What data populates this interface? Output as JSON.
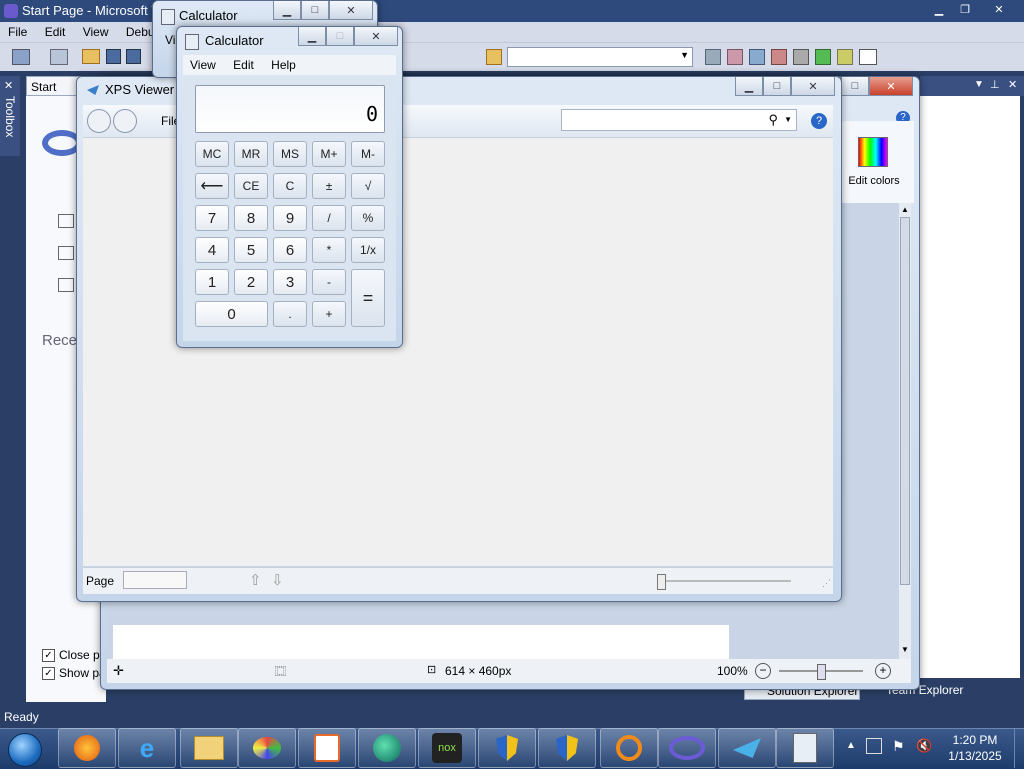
{
  "vs": {
    "title": "Start Page - Microsoft V",
    "menu": [
      "File",
      "Edit",
      "View",
      "Debug"
    ],
    "start_tab": "Start Page",
    "toolbox": "Toolbox",
    "recent": "Rece",
    "close_page": "Close pa",
    "show_page": "Show pa",
    "status": "Ready",
    "solution_explorer": "Solution Explorer",
    "team_explorer": "Team Explorer"
  },
  "calc_back": {
    "title": "Calculator",
    "menu_fragment": "Vi"
  },
  "calc": {
    "title": "Calculator",
    "menu": [
      "View",
      "Edit",
      "Help"
    ],
    "display": "0",
    "memory_row": [
      "MC",
      "MR",
      "MS",
      "M+",
      "M-"
    ],
    "row2": [
      "⟵",
      "CE",
      "C",
      "±",
      "√"
    ],
    "row3": [
      "7",
      "8",
      "9",
      "/",
      "%"
    ],
    "row4": [
      "4",
      "5",
      "6",
      "*",
      "1/x"
    ],
    "row5": [
      "1",
      "2",
      "3",
      "-"
    ],
    "row6": [
      "0",
      ".",
      "+"
    ],
    "equals": "="
  },
  "xps": {
    "title": "XPS Viewer",
    "file_menu": "File",
    "page_label": "Page",
    "page_value": ""
  },
  "paint": {
    "edit_colors": "Edit colors",
    "dimensions": "614 × 460px",
    "zoom": "100%"
  },
  "taskbar": {
    "time": "1:20 PM",
    "date": "1/13/2025"
  },
  "colors": {
    "taskbar": "#1d3b6a",
    "vs_bg": "#2b3f66",
    "window_frame": "#c4d5ea"
  }
}
